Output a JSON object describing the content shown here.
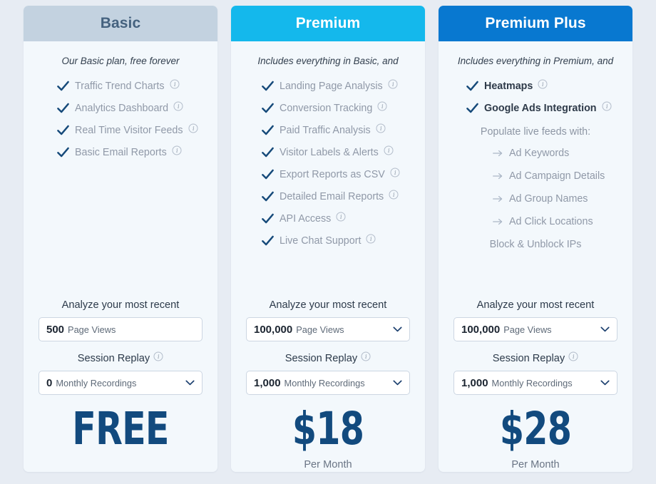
{
  "colors": {
    "page_background": "#e7ecf3",
    "card_background": "#f3f8fc",
    "basic_header": "#c3d2e0",
    "basic_header_text": "#45627f",
    "premium_header": "#14b8ec",
    "plus_header": "#0878d0",
    "check": "#164a7a",
    "price": "#124a7e",
    "feature_text": "#9099a8"
  },
  "icons": {
    "check": "check-icon",
    "info": "info-icon",
    "arrow": "arrow-right-icon",
    "chevron": "chevron-down-icon"
  },
  "plans": [
    {
      "id": "basic",
      "name": "Basic",
      "tagline": "Our Basic plan, free forever",
      "features": [
        {
          "label": "Traffic Trend Charts",
          "info": true,
          "bold": false
        },
        {
          "label": "Analytics Dashboard",
          "info": true,
          "bold": false
        },
        {
          "label": "Real Time Visitor Feeds",
          "info": true,
          "bold": false
        },
        {
          "label": "Basic Email Reports",
          "info": true,
          "bold": false
        }
      ],
      "sub_title": "",
      "sub_items": [],
      "plain_items": [],
      "page_views": {
        "caption": "Analyze your most recent",
        "value": "500",
        "unit": "Page Views",
        "dropdown": false
      },
      "session_replay": {
        "caption": "Session Replay",
        "info": true,
        "value": "0",
        "unit": "Monthly Recordings",
        "dropdown": true
      },
      "price": "FREE",
      "price_period": ""
    },
    {
      "id": "premium",
      "name": "Premium",
      "tagline": "Includes everything in Basic, and",
      "features": [
        {
          "label": "Landing Page Analysis",
          "info": true,
          "bold": false
        },
        {
          "label": "Conversion Tracking",
          "info": true,
          "bold": false
        },
        {
          "label": "Paid Traffic Analysis",
          "info": true,
          "bold": false
        },
        {
          "label": "Visitor Labels & Alerts",
          "info": true,
          "bold": false
        },
        {
          "label": "Export Reports as CSV",
          "info": true,
          "bold": false
        },
        {
          "label": "Detailed Email Reports",
          "info": true,
          "bold": false
        },
        {
          "label": "API Access",
          "info": true,
          "bold": false
        },
        {
          "label": "Live Chat Support",
          "info": true,
          "bold": false
        }
      ],
      "sub_title": "",
      "sub_items": [],
      "plain_items": [],
      "page_views": {
        "caption": "Analyze your most recent",
        "value": "100,000",
        "unit": "Page Views",
        "dropdown": true
      },
      "session_replay": {
        "caption": "Session Replay",
        "info": true,
        "value": "1,000",
        "unit": "Monthly Recordings",
        "dropdown": true
      },
      "price": "$18",
      "price_period": "Per Month"
    },
    {
      "id": "plus",
      "name": "Premium Plus",
      "tagline": "Includes everything in Premium, and",
      "features": [
        {
          "label": "Heatmaps",
          "info": true,
          "bold": true
        },
        {
          "label": "Google Ads Integration",
          "info": true,
          "bold": true
        }
      ],
      "sub_title": "Populate live feeds with:",
      "sub_items": [
        {
          "label": "Ad Keywords"
        },
        {
          "label": "Ad Campaign Details"
        },
        {
          "label": "Ad Group Names"
        },
        {
          "label": "Ad Click Locations"
        }
      ],
      "plain_items": [
        {
          "label": "Block & Unblock IPs"
        }
      ],
      "page_views": {
        "caption": "Analyze your most recent",
        "value": "100,000",
        "unit": "Page Views",
        "dropdown": true
      },
      "session_replay": {
        "caption": "Session Replay",
        "info": true,
        "value": "1,000",
        "unit": "Monthly Recordings",
        "dropdown": true
      },
      "price": "$28",
      "price_period": "Per Month"
    }
  ]
}
